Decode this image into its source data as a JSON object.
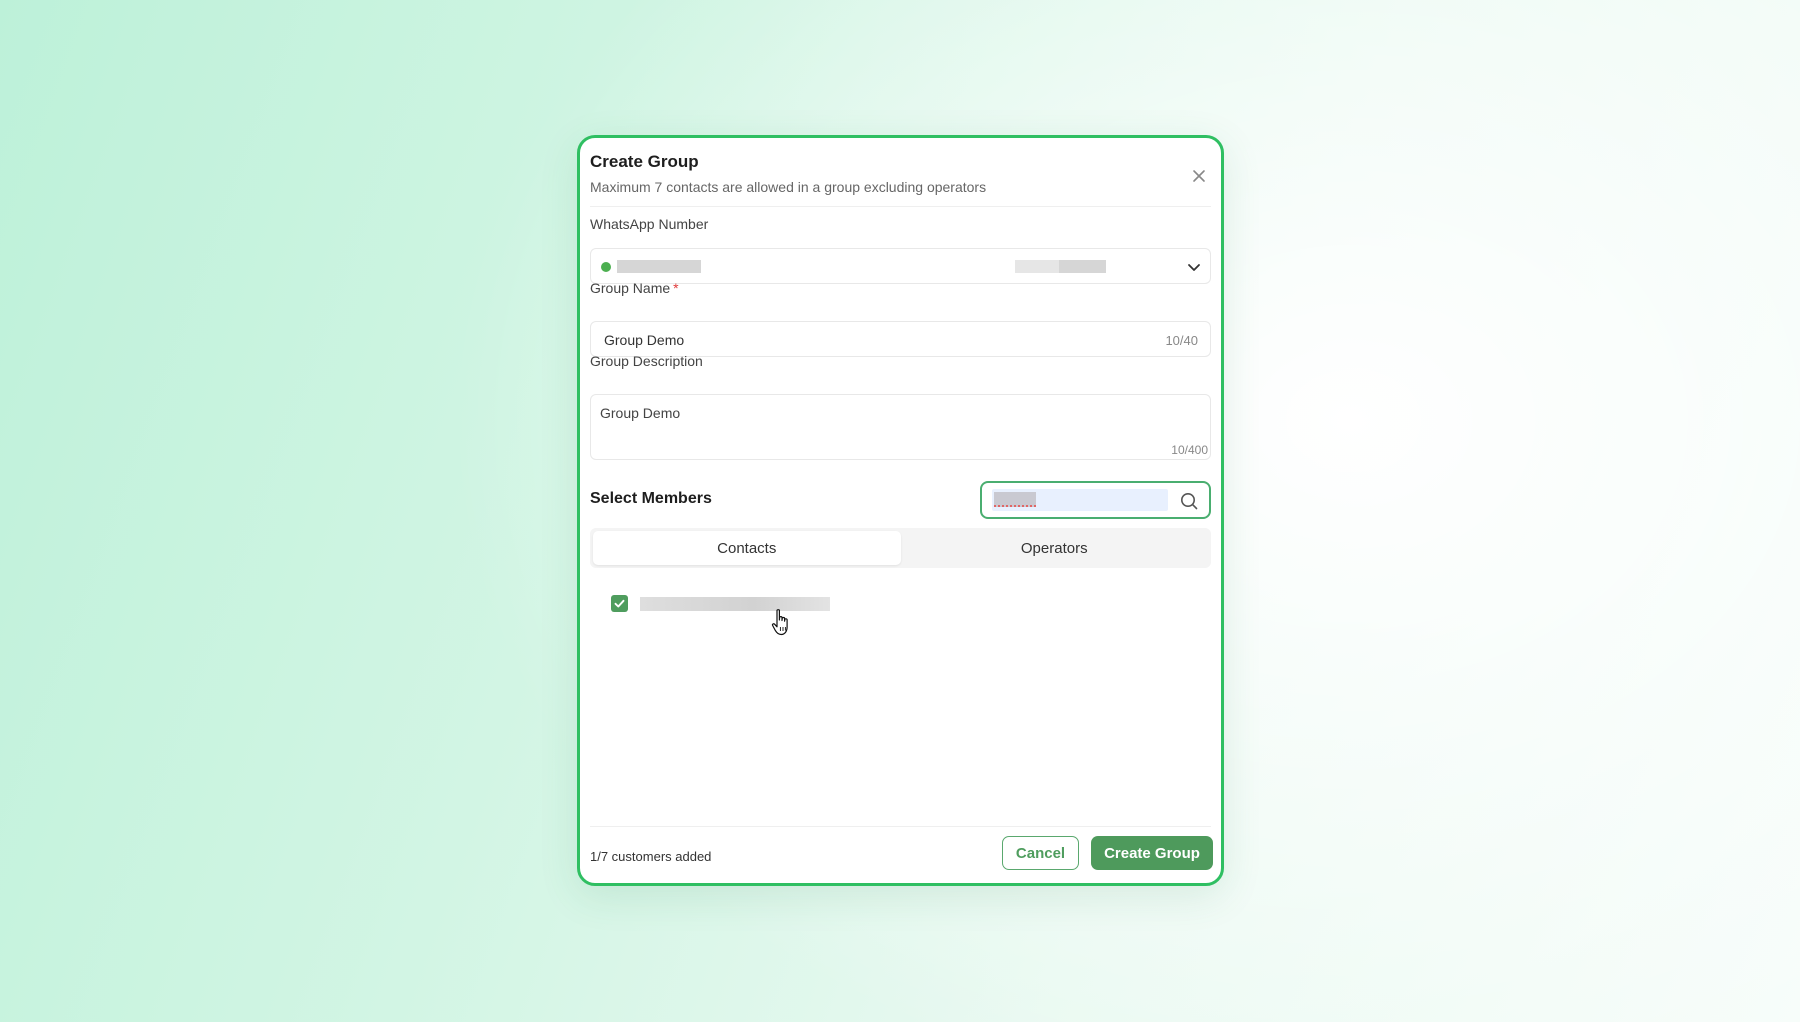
{
  "modal": {
    "title": "Create Group",
    "subtitle": "Maximum 7 contacts are allowed in a group excluding operators",
    "close_icon": "close-icon"
  },
  "whatsapp": {
    "label": "WhatsApp Number",
    "status_color": "#4caf50"
  },
  "group_name": {
    "label": "Group Name",
    "required_mark": "*",
    "value": "Group Demo",
    "counter": "10/40"
  },
  "group_description": {
    "label": "Group Description",
    "value": "Group Demo",
    "counter": "10/400"
  },
  "members": {
    "title": "Select Members",
    "search_icon": "search-icon",
    "tabs": [
      {
        "label": "Contacts",
        "active": true
      },
      {
        "label": "Operators",
        "active": false
      }
    ]
  },
  "footer": {
    "added_text": "1/7 customers added",
    "cancel_label": "Cancel",
    "create_label": "Create Group"
  },
  "colors": {
    "accent": "#4e9a5c",
    "border": "#2fbf62",
    "required": "#e03a3a"
  }
}
